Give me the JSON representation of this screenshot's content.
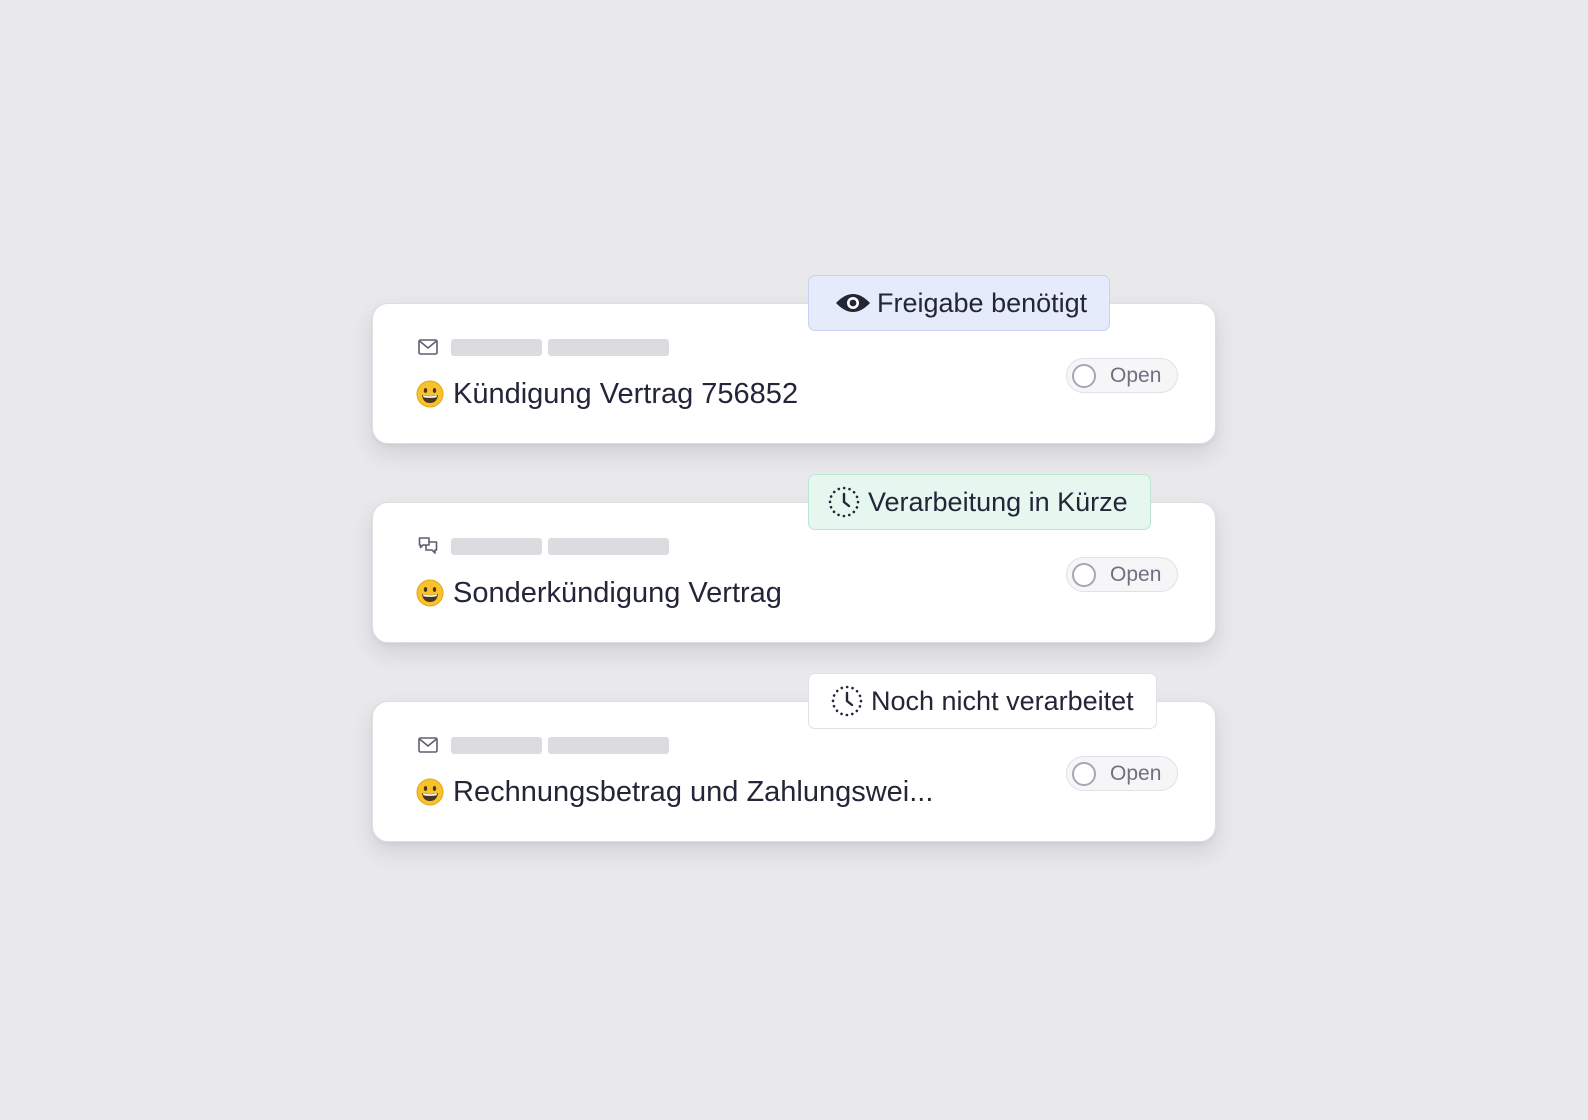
{
  "tickets": [
    {
      "channel_icon": "mail-icon",
      "emoji": "grinning-face",
      "title": "Kündigung Vertrag 756852",
      "status": "Open",
      "badge": {
        "icon": "eye-icon",
        "label": "Freigabe benötigt",
        "color": "#e6ebfb"
      }
    },
    {
      "channel_icon": "chat-bubbles-icon",
      "emoji": "grinning-face",
      "title": "Sonderkündigung Vertrag",
      "status": "Open",
      "badge": {
        "icon": "dotted-clock-icon",
        "label": "Verarbeitung in Kürze",
        "color": "#e5f7ef"
      }
    },
    {
      "channel_icon": "mail-icon",
      "emoji": "grinning-face",
      "title": "Rechnungsbetrag und Zahlungswei...",
      "status": "Open",
      "badge": {
        "icon": "dotted-clock-icon",
        "label": "Noch nicht verarbeitet",
        "color": "#ffffff"
      }
    }
  ]
}
